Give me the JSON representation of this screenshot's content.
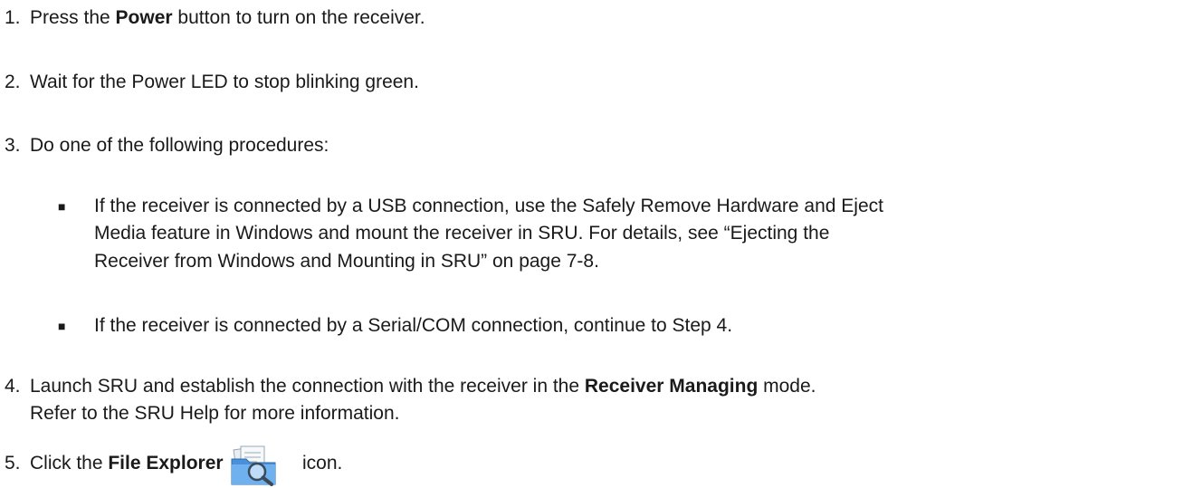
{
  "steps": [
    {
      "number": "1.",
      "pre": "Press the ",
      "bold": "Power",
      "post": " button to turn on the receiver."
    },
    {
      "number": "2.",
      "text": "Wait for the Power LED to stop blinking green."
    },
    {
      "number": "3.",
      "text": "Do one of the following procedures:"
    },
    {
      "number": "4.",
      "pre": "Launch SRU and establish the connection with the receiver in the ",
      "bold": "Receiver Managing",
      "post": " mode.",
      "line2": "Refer to the SRU Help for more information."
    },
    {
      "number": "5.",
      "pre": "Click the ",
      "bold": "File Explorer",
      "post": "icon.",
      "icon": "file-explorer-icon"
    }
  ],
  "bullets": [
    {
      "symbol": "■",
      "lines": [
        "If the receiver is connected by a USB connection, use the Safely Remove Hardware and Eject",
        "Media feature in Windows and mount the receiver in SRU. For details, see “Ejecting the",
        "Receiver from Windows and Mounting in SRU” on page 7-8."
      ]
    },
    {
      "symbol": "■",
      "lines": [
        "If the receiver is connected by a Serial/COM connection, continue to Step 4."
      ]
    }
  ]
}
